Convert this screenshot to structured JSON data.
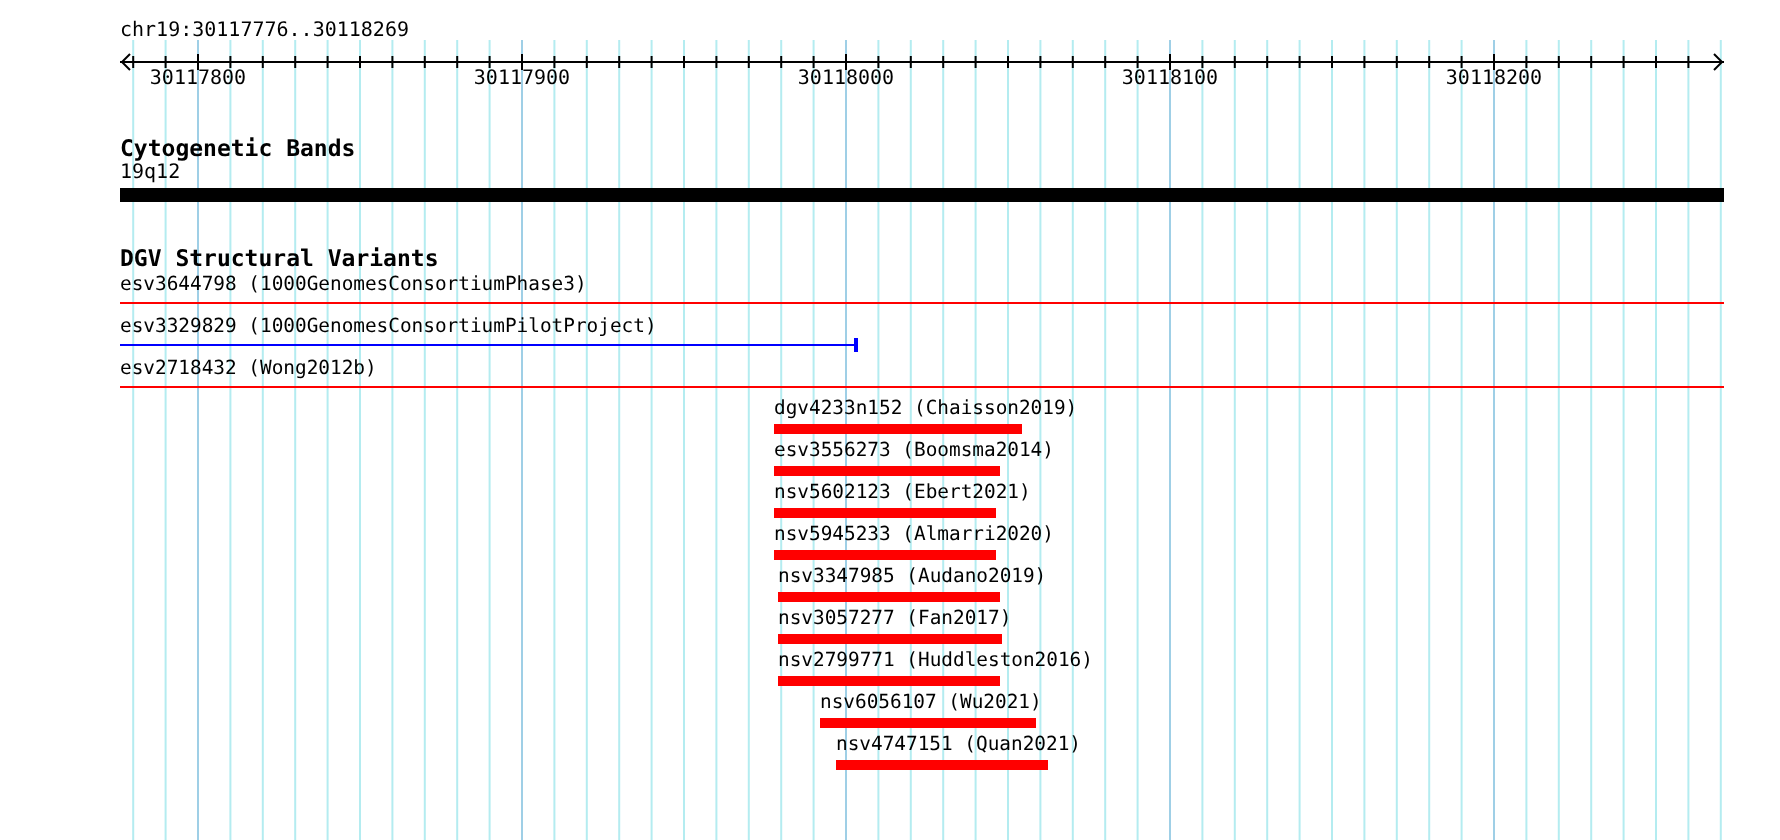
{
  "ruler": {
    "location": "chr19:30117776..30118269",
    "ticks": [
      {
        "label": "30117800"
      },
      {
        "label": "30117900"
      },
      {
        "label": "30118000"
      },
      {
        "label": "30118100"
      },
      {
        "label": "30118200"
      }
    ]
  },
  "tracks": [
    {
      "title": "Cytogenetic Bands",
      "kind": "bands",
      "bands": [
        {
          "label": "19q12",
          "color": "#000000"
        }
      ]
    },
    {
      "title": "DGV Structural Variants",
      "kind": "variants",
      "features": [
        {
          "label": "esv3644798 (1000GenomesConsortiumPhase3)",
          "kind": "line",
          "color": "#ff0000"
        },
        {
          "label": "esv3329829 (1000GenomesConsortiumPilotProject)",
          "kind": "line",
          "color": "#0000ff"
        },
        {
          "label": "esv2718432 (Wong2012b)",
          "kind": "line",
          "color": "#ff0000"
        },
        {
          "label": "dgv4233n152 (Chaisson2019)",
          "kind": "bar",
          "color": "#ff0000"
        },
        {
          "label": "esv3556273 (Boomsma2014)",
          "kind": "bar",
          "color": "#ff0000"
        },
        {
          "label": "nsv5602123 (Ebert2021)",
          "kind": "bar",
          "color": "#ff0000"
        },
        {
          "label": "nsv5945233 (Almarri2020)",
          "kind": "bar",
          "color": "#ff0000"
        },
        {
          "label": "nsv3347985 (Audano2019)",
          "kind": "bar",
          "color": "#ff0000"
        },
        {
          "label": "nsv3057277 (Fan2017)",
          "kind": "bar",
          "color": "#ff0000"
        },
        {
          "label": "nsv2799771 (Huddleston2016)",
          "kind": "bar",
          "color": "#ff0000"
        },
        {
          "label": "nsv6056107 (Wu2021)",
          "kind": "bar",
          "color": "#ff0000"
        },
        {
          "label": "nsv4747151 (Quan2021)",
          "kind": "bar",
          "color": "#ff0000"
        }
      ]
    }
  ]
}
